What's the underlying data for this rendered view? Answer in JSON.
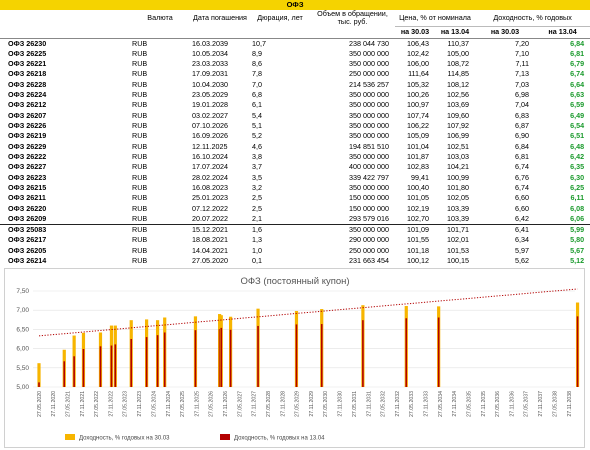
{
  "table": {
    "title": "ОФЗ",
    "headers": {
      "currency": "Валюта",
      "maturity": "Дата погашения",
      "duration": "Дюрация, лет",
      "volume": "Объем в обращении, тыс. руб.",
      "price": "Цена, % от номинала",
      "yield": "Доходность, % годовых"
    },
    "subheaders": {
      "price_d1": "на 30.03",
      "price_d2": "на 13.04",
      "yield_d1": "на 30.03",
      "yield_d2": "на 13.04"
    },
    "rows": [
      {
        "name": "ОФЗ 26230",
        "cur": "RUB",
        "date": "16.03.2039",
        "dur": "10,7",
        "vol": "238 044 730",
        "p1": "106,43",
        "p2": "110,37",
        "y1": "7,20",
        "y2": "6,84"
      },
      {
        "name": "ОФЗ 26225",
        "cur": "RUB",
        "date": "10.05.2034",
        "dur": "8,9",
        "vol": "350 000 000",
        "p1": "102,42",
        "p2": "105,00",
        "y1": "7,10",
        "y2": "6,81"
      },
      {
        "name": "ОФЗ 26221",
        "cur": "RUB",
        "date": "23.03.2033",
        "dur": "8,6",
        "vol": "350 000 000",
        "p1": "106,00",
        "p2": "108,72",
        "y1": "7,11",
        "y2": "6,79"
      },
      {
        "name": "ОФЗ 26218",
        "cur": "RUB",
        "date": "17.09.2031",
        "dur": "7,8",
        "vol": "250 000 000",
        "p1": "111,64",
        "p2": "114,85",
        "y1": "7,13",
        "y2": "6,74"
      },
      {
        "name": "ОФЗ 26228",
        "cur": "RUB",
        "date": "10.04.2030",
        "dur": "7,0",
        "vol": "214 536 257",
        "p1": "105,32",
        "p2": "108,12",
        "y1": "7,03",
        "y2": "6,64"
      },
      {
        "name": "ОФЗ 26224",
        "cur": "RUB",
        "date": "23.05.2029",
        "dur": "6,8",
        "vol": "350 000 000",
        "p1": "100,26",
        "p2": "102,56",
        "y1": "6,98",
        "y2": "6,63"
      },
      {
        "name": "ОФЗ 26212",
        "cur": "RUB",
        "date": "19.01.2028",
        "dur": "6,1",
        "vol": "350 000 000",
        "p1": "100,97",
        "p2": "103,69",
        "y1": "7,04",
        "y2": "6,59"
      },
      {
        "name": "ОФЗ 26207",
        "cur": "RUB",
        "date": "03.02.2027",
        "dur": "5,4",
        "vol": "350 000 000",
        "p1": "107,74",
        "p2": "109,60",
        "y1": "6,83",
        "y2": "6,49"
      },
      {
        "name": "ОФЗ 26226",
        "cur": "RUB",
        "date": "07.10.2026",
        "dur": "5,1",
        "vol": "350 000 000",
        "p1": "106,22",
        "p2": "107,92",
        "y1": "6,87",
        "y2": "6,54"
      },
      {
        "name": "ОФЗ 26219",
        "cur": "RUB",
        "date": "16.09.2026",
        "dur": "5,2",
        "vol": "350 000 000",
        "p1": "105,09",
        "p2": "106,99",
        "y1": "6,90",
        "y2": "6,51"
      },
      {
        "name": "ОФЗ 26229",
        "cur": "RUB",
        "date": "12.11.2025",
        "dur": "4,6",
        "vol": "194 851 510",
        "p1": "101,04",
        "p2": "102,51",
        "y1": "6,84",
        "y2": "6,48"
      },
      {
        "name": "ОФЗ 26222",
        "cur": "RUB",
        "date": "16.10.2024",
        "dur": "3,8",
        "vol": "350 000 000",
        "p1": "101,87",
        "p2": "103,03",
        "y1": "6,81",
        "y2": "6,42"
      },
      {
        "name": "ОФЗ 26227",
        "cur": "RUB",
        "date": "17.07.2024",
        "dur": "3,7",
        "vol": "400 000 000",
        "p1": "102,83",
        "p2": "104,21",
        "y1": "6,74",
        "y2": "6,35"
      },
      {
        "name": "ОФЗ 26223",
        "cur": "RUB",
        "date": "28.02.2024",
        "dur": "3,5",
        "vol": "339 422 797",
        "p1": "99,41",
        "p2": "100,99",
        "y1": "6,76",
        "y2": "6,30"
      },
      {
        "name": "ОФЗ 26215",
        "cur": "RUB",
        "date": "16.08.2023",
        "dur": "3,2",
        "vol": "350 000 000",
        "p1": "100,40",
        "p2": "101,80",
        "y1": "6,74",
        "y2": "6,25"
      },
      {
        "name": "ОФЗ 26211",
        "cur": "RUB",
        "date": "25.01.2023",
        "dur": "2,5",
        "vol": "150 000 000",
        "p1": "101,05",
        "p2": "102,05",
        "y1": "6,60",
        "y2": "6,11"
      },
      {
        "name": "ОФЗ 26220",
        "cur": "RUB",
        "date": "07.12.2022",
        "dur": "2,5",
        "vol": "150 000 000",
        "p1": "102,19",
        "p2": "103,39",
        "y1": "6,60",
        "y2": "6,08"
      },
      {
        "name": "ОФЗ 26209",
        "cur": "RUB",
        "date": "20.07.2022",
        "dur": "2,1",
        "vol": "293 579 016",
        "p1": "102,70",
        "p2": "103,39",
        "y1": "6,42",
        "y2": "6,06"
      },
      {
        "name": "ОФЗ 25083",
        "cur": "RUB",
        "date": "15.12.2021",
        "dur": "1,6",
        "vol": "350 000 000",
        "p1": "101,09",
        "p2": "101,71",
        "y1": "6,41",
        "y2": "5,99",
        "sep": true
      },
      {
        "name": "ОФЗ 26217",
        "cur": "RUB",
        "date": "18.08.2021",
        "dur": "1,3",
        "vol": "290 000 000",
        "p1": "101,55",
        "p2": "102,01",
        "y1": "6,34",
        "y2": "5,80"
      },
      {
        "name": "ОФЗ 26205",
        "cur": "RUB",
        "date": "14.04.2021",
        "dur": "1,0",
        "vol": "250 000 000",
        "p1": "101,18",
        "p2": "101,53",
        "y1": "5,97",
        "y2": "5,67"
      },
      {
        "name": "ОФЗ 26214",
        "cur": "RUB",
        "date": "27.05.2020",
        "dur": "0,1",
        "vol": "231 663 454",
        "p1": "100,12",
        "p2": "100,15",
        "y1": "5,62",
        "y2": "5,12"
      }
    ]
  },
  "chart_data": {
    "type": "bar",
    "title": "ОФЗ (постоянный купон)",
    "ylim": [
      5.0,
      7.5
    ],
    "yticks": [
      "5,00",
      "5,50",
      "6,00",
      "6,50",
      "7,00",
      "7,50"
    ],
    "xticks": [
      "27.05.2020",
      "27.11.2020",
      "27.05.2021",
      "27.11.2021",
      "27.05.2022",
      "27.11.2022",
      "27.05.2023",
      "27.11.2023",
      "27.05.2024",
      "27.11.2024",
      "27.05.2025",
      "27.11.2025",
      "27.05.2026",
      "27.11.2026",
      "27.05.2027",
      "27.11.2027",
      "27.05.2028",
      "27.11.2028",
      "27.05.2029",
      "27.11.2029",
      "27.05.2030",
      "27.11.2030",
      "27.05.2031",
      "27.11.2031",
      "27.05.2032",
      "27.11.2032",
      "27.05.2033",
      "27.11.2033",
      "27.05.2034",
      "27.11.2034",
      "27.05.2035",
      "27.11.2035",
      "27.05.2036",
      "27.11.2036",
      "27.05.2037",
      "27.11.2037",
      "27.05.2038",
      "27.11.2038"
    ],
    "x": [
      "2020-05-27",
      "2021-04-14",
      "2021-08-18",
      "2021-12-15",
      "2022-07-20",
      "2022-12-07",
      "2023-01-25",
      "2023-08-16",
      "2024-02-28",
      "2024-07-17",
      "2024-10-16",
      "2025-11-12",
      "2026-09-16",
      "2026-10-07",
      "2027-02-03",
      "2028-01-19",
      "2029-05-23",
      "2030-04-10",
      "2031-09-17",
      "2033-03-23",
      "2034-05-10",
      "2039-03-16"
    ],
    "series": [
      {
        "name": "Доходность, % годовых на 30.03",
        "color": "#f7b500",
        "values": [
          5.62,
          5.97,
          6.34,
          6.41,
          6.42,
          6.6,
          6.6,
          6.74,
          6.76,
          6.74,
          6.81,
          6.84,
          6.9,
          6.87,
          6.83,
          7.04,
          6.98,
          7.03,
          7.13,
          7.11,
          7.1,
          7.2
        ]
      },
      {
        "name": "Доходность, % годовых на 13.04",
        "color": "#b30000",
        "values": [
          5.12,
          5.67,
          5.8,
          5.99,
          6.06,
          6.08,
          6.11,
          6.25,
          6.3,
          6.35,
          6.42,
          6.48,
          6.51,
          6.54,
          6.49,
          6.59,
          6.63,
          6.64,
          6.74,
          6.79,
          6.81,
          6.84
        ]
      }
    ],
    "trendline": {
      "color": "#b30000",
      "style": "dotted"
    },
    "grid": true,
    "legend_position": "bottom"
  }
}
